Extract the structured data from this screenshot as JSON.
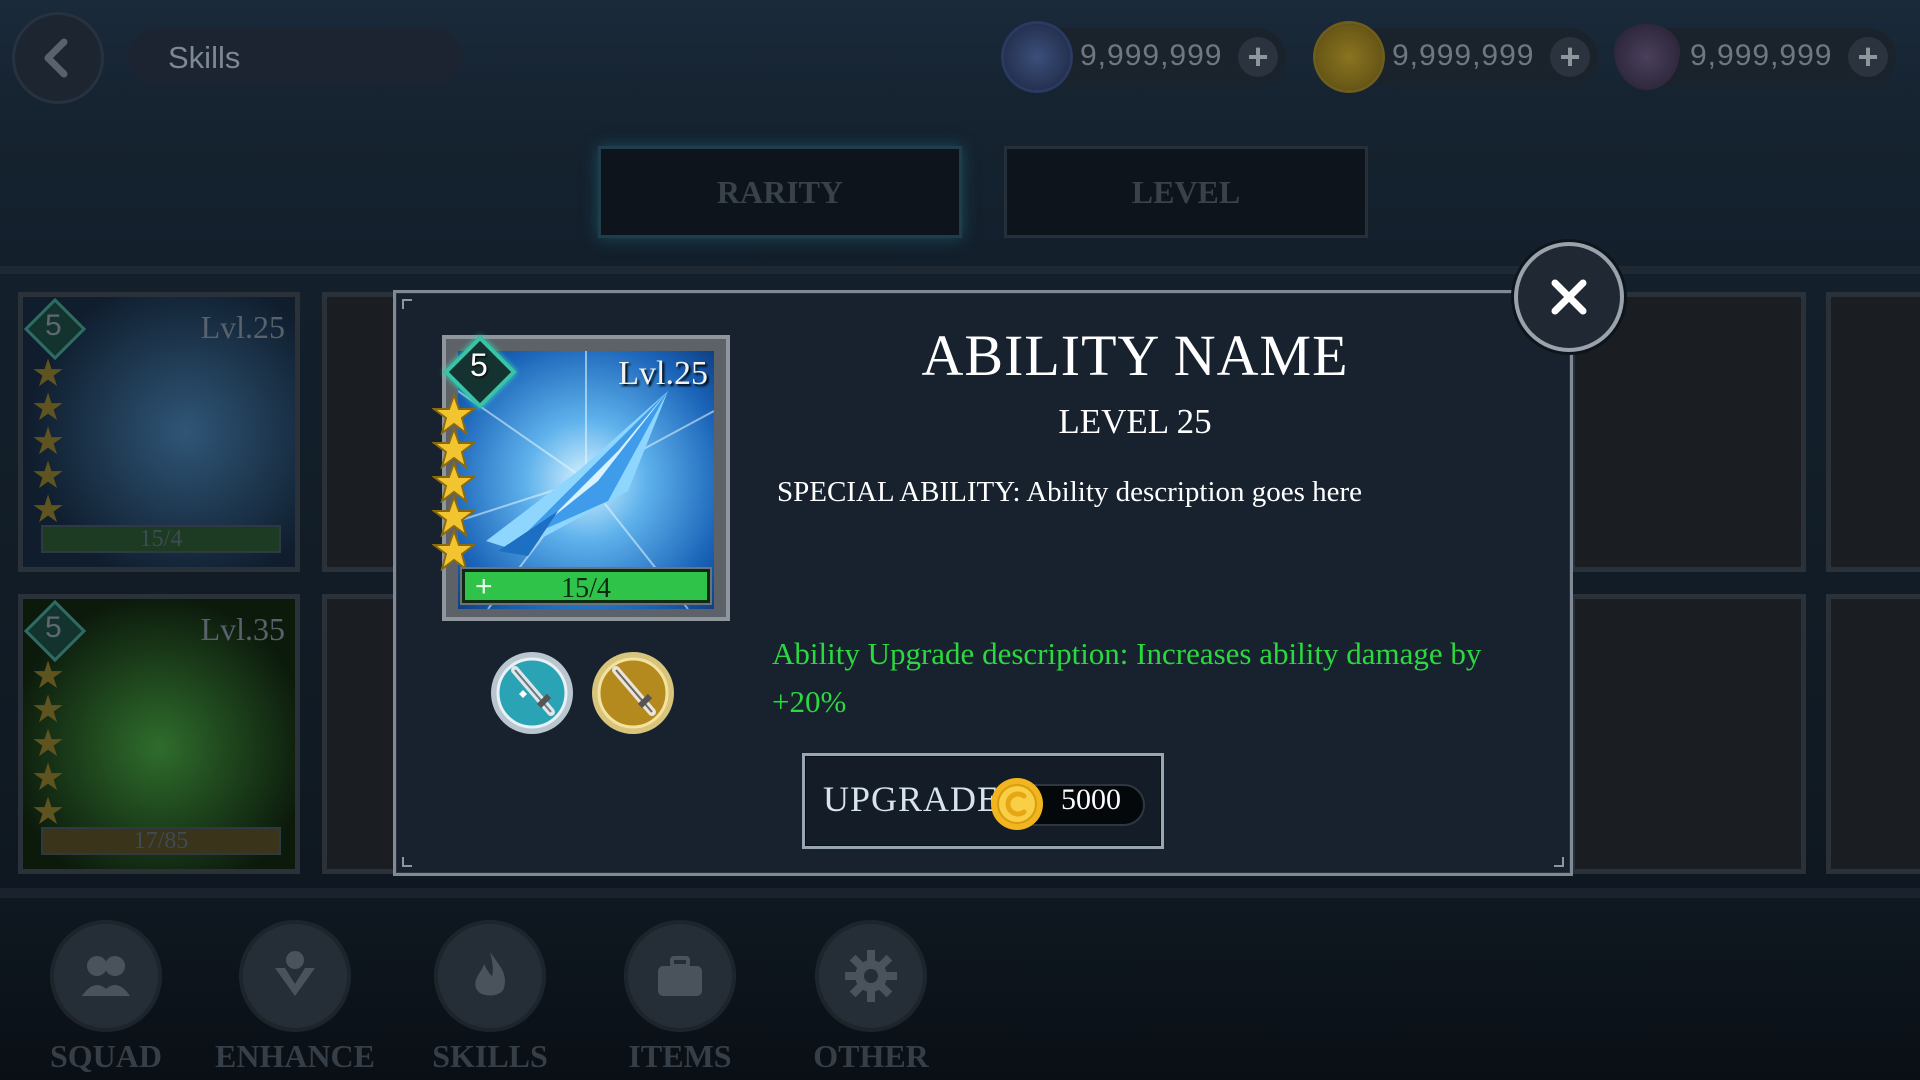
{
  "header": {
    "title": "Skills",
    "currencies": [
      {
        "icon": "energy-icon",
        "amount": "9,999,999"
      },
      {
        "icon": "gold-coin-icon",
        "amount": "9,999,999"
      },
      {
        "icon": "gem-icon",
        "amount": "9,999,999"
      }
    ]
  },
  "tabs": [
    {
      "label": "RARITY"
    },
    {
      "label": "LEVEL"
    }
  ],
  "bg_cards": [
    {
      "level": "Lvl.25",
      "tier": "5",
      "progress": "15/4",
      "stars": 5,
      "theme": "blue"
    },
    {
      "level": "Lvl.35",
      "tier": "5",
      "progress": "17/85",
      "stars": 5,
      "theme": "green"
    }
  ],
  "bottom_nav": [
    {
      "label": "SQUAD",
      "icon": "squad-icon"
    },
    {
      "label": "ENHANCE",
      "icon": "enhance-icon"
    },
    {
      "label": "SKILLS",
      "icon": "flame-icon"
    },
    {
      "label": "ITEMS",
      "icon": "briefcase-icon"
    },
    {
      "label": "OTHER",
      "icon": "gear-icon"
    }
  ],
  "modal": {
    "card": {
      "tier": "5",
      "level": "Lvl.25",
      "progress": "15/4",
      "progress_plus": "+",
      "stars": 5
    },
    "ability_name": "ABILITY NAME",
    "level_text": "LEVEL 25",
    "description": "SPECIAL ABILITY: Ability description goes here",
    "upgrade_description": "Ability Upgrade description: Increases ability damage by +20%",
    "upgrade_button": {
      "label": "UPGRADE",
      "cost": "5000",
      "currency_icon": "gold-coin-icon"
    },
    "medals": [
      {
        "icon": "sword-medal-silver-icon"
      },
      {
        "icon": "sword-medal-gold-icon"
      }
    ]
  },
  "colors": {
    "accent_green": "#2bd83f",
    "progress_green": "#2fc34a",
    "modal_bg": "#18222f",
    "tier_teal": "#39c4a8",
    "gold": "#e8b22a"
  }
}
